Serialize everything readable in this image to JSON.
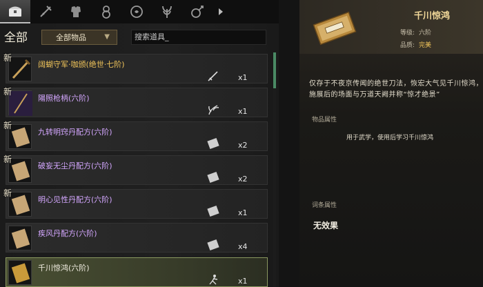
{
  "tabs": [
    {
      "icon": "chest-icon",
      "active": true
    },
    {
      "icon": "weapon-icon",
      "active": false
    },
    {
      "icon": "armor-icon",
      "active": false
    },
    {
      "icon": "gourd-icon",
      "active": false
    },
    {
      "icon": "medicine-icon",
      "active": false
    },
    {
      "icon": "herb-icon",
      "active": false
    },
    {
      "icon": "misc-icon",
      "active": false
    }
  ],
  "filter": {
    "category_all": "全部",
    "category_select": "全部物品",
    "search_text": "搜索道具_"
  },
  "items": [
    {
      "name": "阔蝴守军·咖颁(绝世·七阶)",
      "new": "新",
      "quantity": "x1",
      "icon": "sword-icon",
      "color": "gold"
    },
    {
      "name": "陽照枪柄(六阶)",
      "new": "新",
      "quantity": "x1",
      "icon": "feather-icon",
      "color": "purple"
    },
    {
      "name": "九转明窍丹配方(六阶)",
      "new": "新",
      "quantity": "x2",
      "icon": "scroll-icon",
      "color": "purple"
    },
    {
      "name": "破妄无尘丹配方(六阶)",
      "new": "新",
      "quantity": "x2",
      "icon": "scroll-icon",
      "color": "purple"
    },
    {
      "name": "明心见性丹配方(六阶)",
      "new": "新",
      "quantity": "x1",
      "icon": "scroll-icon",
      "color": "purple"
    },
    {
      "name": "疾风丹配方(六阶)",
      "new": "",
      "quantity": "x4",
      "icon": "scroll-icon",
      "color": "purple"
    },
    {
      "name": "千川惊鸿(六阶)",
      "new": "",
      "quantity": "x1",
      "icon": "martial-icon",
      "color": "white",
      "selected": true
    }
  ],
  "detail": {
    "title": "千川惊鸿",
    "grade_label": "等级:",
    "grade_value": "六阶",
    "quality_label": "品质:",
    "quality_value": "完美",
    "description": "仅存于不夜京传闻的绝世刀法，恢宏大气见千川惊鸿，施展后的场面与万道天阙并称“惊才绝景”",
    "attr_heading": "物品属性",
    "attr_text": "用于武学，使用后学习千川惊鸿",
    "entry_heading": "词条属性",
    "entry_text": "无效果"
  },
  "colors": {
    "gold": "#f0c45a",
    "purple": "#d4a7ff",
    "selected_border": "#8a9860",
    "scroll_accent": "#4a8a64"
  }
}
